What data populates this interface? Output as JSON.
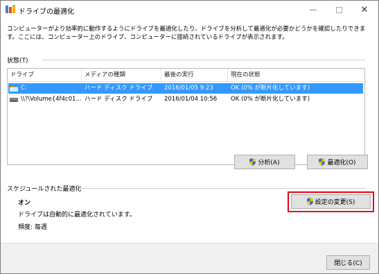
{
  "window": {
    "title": "ドライブの最適化"
  },
  "description": "コンピューターがより効率的に動作するようにドライブを最適化したり、ドライブを分析して最適化が必要かどうかを確認したりできます。ここには、コンピューター上のドライブ、コンピューターに接続されているドライブが表示されます。",
  "status_section": {
    "label": "状態(T)"
  },
  "table": {
    "columns": [
      "ドライブ",
      "メディアの種類",
      "最後の実行",
      "現在の状態"
    ],
    "rows": [
      {
        "drive": "C:",
        "media": "ハード ディスク ドライブ",
        "last_run": "2016/01/05 9:23",
        "status": "OK (0% が断片化しています)",
        "selected": true
      },
      {
        "drive": "\\\\?\\Volume{4f4c01...",
        "media": "ハード ディスク ドライブ",
        "last_run": "2016/01/04 10:56",
        "status": "OK (0% が断片化しています)",
        "selected": false
      }
    ]
  },
  "buttons": {
    "analyze": "分析(A)",
    "optimize": "最適化(O)",
    "change_settings": "設定の変更(S)",
    "close": "閉じる(C)"
  },
  "schedule": {
    "label": "スケジュールされた最適化",
    "state": "オン",
    "description": "ドライブは自動的に最適化されています。",
    "frequency": "頻度: 毎週"
  },
  "colors": {
    "selection": "#3399ff",
    "highlight_border": "#e60012"
  }
}
